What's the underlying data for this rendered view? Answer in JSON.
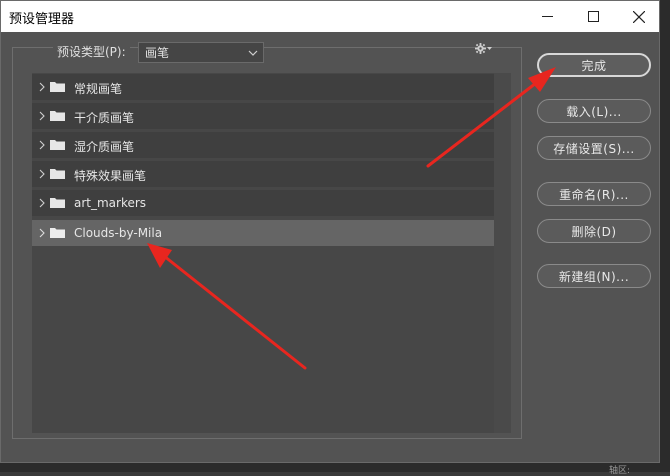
{
  "window": {
    "title": "预设管理器"
  },
  "preset_type": {
    "label": "预设类型(P):",
    "selected": "画笔"
  },
  "presets": [
    {
      "label": "常规画笔",
      "selected": false
    },
    {
      "label": "干介质画笔",
      "selected": false
    },
    {
      "label": "湿介质画笔",
      "selected": false
    },
    {
      "label": "特殊效果画笔",
      "selected": false
    },
    {
      "label": "art_markers",
      "selected": false
    },
    {
      "label": "Clouds-by-Mila",
      "selected": true
    }
  ],
  "buttons": {
    "done": "完成",
    "load": "载入(L)...",
    "save_set": "存储设置(S)...",
    "rename": "重命名(R)...",
    "delete": "删除(D)",
    "new_group": "新建组(N)..."
  },
  "background": {
    "bottom_text": "轴区:"
  },
  "colors": {
    "dialog_bg": "#535353",
    "list_row": "#3f3f3f",
    "selected_row": "#656565",
    "annotation": "#e8261f"
  }
}
